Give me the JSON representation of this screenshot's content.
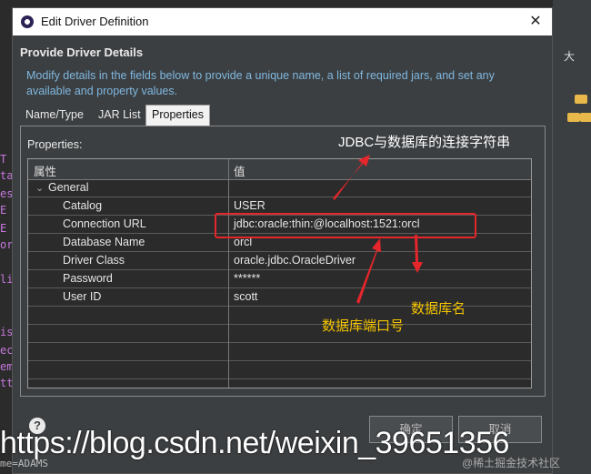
{
  "background": {
    "code_fragments": [
      "T",
      "ta",
      "es",
      "E",
      "E",
      "or",
      "li",
      "is",
      "ec",
      "em",
      "tt"
    ],
    "right_tab": "大",
    "bottom_text": "me=ADAMS"
  },
  "dialog": {
    "title": "Edit Driver Definition",
    "close_glyph": "✕",
    "header_title": "Provide Driver Details",
    "header_desc": "Modify details in the fields below to provide a unique name, a list of required jars, and set any available and property values.",
    "tabs": [
      {
        "label": "Name/Type"
      },
      {
        "label": "JAR List"
      },
      {
        "label": "Properties"
      }
    ],
    "properties_label": "Properties:",
    "grid": {
      "col_property": "属性",
      "col_value": "值",
      "group": "General",
      "rows": [
        {
          "key": "Catalog",
          "value": "USER"
        },
        {
          "key": "Connection URL",
          "value": "jdbc:oracle:thin:@localhost:1521:orcl"
        },
        {
          "key": "Database Name",
          "value": "orcl"
        },
        {
          "key": "Driver Class",
          "value": "oracle.jdbc.OracleDriver"
        },
        {
          "key": "Password",
          "value": "******"
        },
        {
          "key": "User ID",
          "value": "scott"
        }
      ]
    },
    "help_glyph": "?",
    "ok_label": "确定",
    "cancel_label": "取消"
  },
  "annotations": {
    "connection_string": "JDBC与数据库的连接字符串",
    "db_name": "数据库名",
    "db_port": "数据库端口号"
  },
  "watermark": {
    "url": "https://blog.csdn.net/weixin_39651356",
    "small": "@稀土掘金技术社区"
  },
  "colors": {
    "accent_desc": "#7fb7e0",
    "annotation_white": "#ffffff",
    "annotation_yellow": "#f5c400",
    "highlight_red": "#e5262a"
  }
}
